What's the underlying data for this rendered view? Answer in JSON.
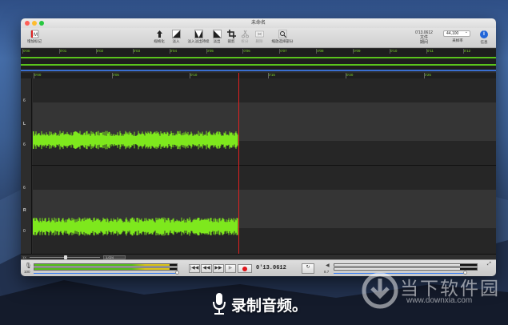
{
  "window": {
    "title": "未命名"
  },
  "toolbar": {
    "add_marker_label": "增加标记",
    "tools": [
      {
        "name": "normalize",
        "label": "规格化",
        "icon": "normalize-icon",
        "enabled": true
      },
      {
        "name": "fade-in",
        "label": "淡入",
        "icon": "fade-in-icon",
        "enabled": true
      },
      {
        "name": "fade-in-out",
        "label": "淡入淡出持续",
        "icon": "fade-in-out-icon",
        "enabled": true
      },
      {
        "name": "fade-out",
        "label": "淡出",
        "icon": "fade-out-icon",
        "enabled": true
      },
      {
        "name": "crop",
        "label": "裁剪",
        "icon": "crop-icon",
        "enabled": true
      },
      {
        "name": "split",
        "label": "拆分",
        "icon": "split-icon",
        "enabled": false
      },
      {
        "name": "delete",
        "label": "删除",
        "icon": "delete-icon",
        "enabled": false
      },
      {
        "name": "zoom-selection",
        "label": "缩放选择部分",
        "icon": "zoom-selection-icon",
        "enabled": true
      }
    ],
    "duration_value": "0'13.0612",
    "duration_sub": "文件",
    "duration_label": "期间",
    "sample_rate_value": "44,100",
    "sample_rate_label": "采样率",
    "info_label": "信息",
    "info_glyph": "i"
  },
  "overview_ticks": [
    "0'00",
    "0'01",
    "0'02",
    "0'03",
    "0'04",
    "0'05",
    "0'06",
    "0'07",
    "0'08",
    "0'09",
    "0'10",
    "0'11",
    "0'12"
  ],
  "ruler_ticks": [
    "0'00",
    "0'05",
    "0'10",
    "0'15",
    "0'20",
    "0'25"
  ],
  "channels": {
    "left": {
      "label": "L",
      "db_top": "6",
      "db_bottom": "6"
    },
    "right": {
      "label": "R",
      "db_top": "6",
      "db_bottom": "0"
    }
  },
  "zoom": {
    "label": "1X",
    "select_value": "1,024"
  },
  "transport": {
    "input_volume_value": "100",
    "output_volume_value": "8.7",
    "time": "0'13.0612",
    "btn_start": "|◀◀",
    "btn_rewind": "◀◀",
    "btn_forward": "▶▶",
    "btn_play": "▶",
    "btn_loop": "↻",
    "input_level": 0.95,
    "output_level": 0.88
  },
  "caption": {
    "text": "录制音频。"
  },
  "watermark": {
    "name": "当下软件园",
    "url": "www.downxia.com"
  },
  "colors": {
    "waveform": "#7ee81d",
    "playhead": "#e02020",
    "record": "#e0151b",
    "accent": "#3a6fd1"
  }
}
